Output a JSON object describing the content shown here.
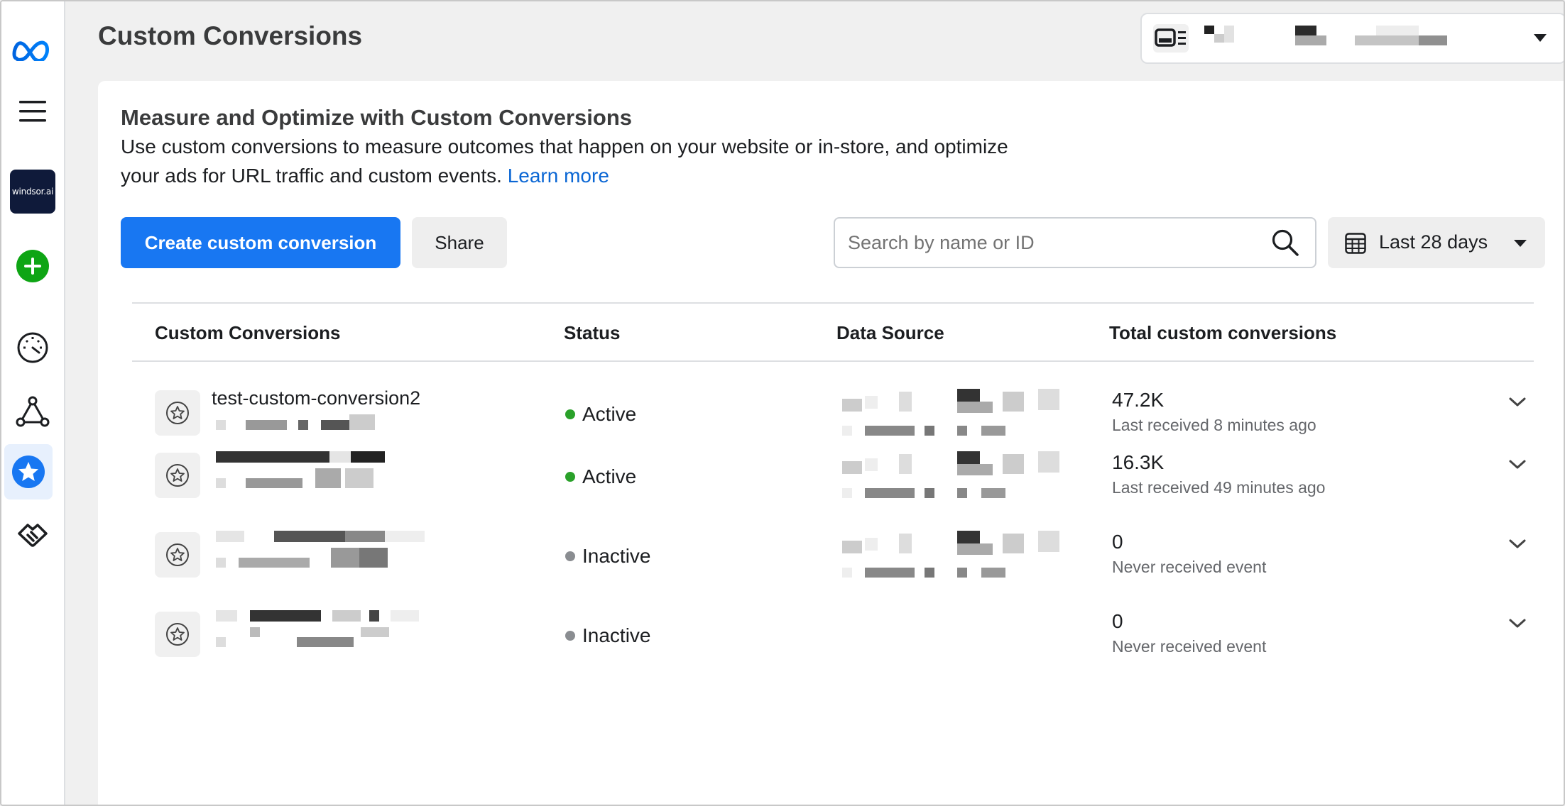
{
  "header": {
    "title": "Custom Conversions"
  },
  "sidebar": {
    "brand_tile_text": "windsor.ai",
    "icons": [
      "meta-logo-icon",
      "menu-icon",
      "brand-tile",
      "create-plus-icon",
      "dashboard-gauge-icon",
      "network-icon",
      "star-icon",
      "partnership-icon"
    ]
  },
  "card": {
    "heading": "Measure and Optimize with Custom Conversions",
    "description": "Use custom conversions to measure outcomes that happen on your website or in-store, and optimize your ads for URL traffic and custom events.",
    "learn_more": "Learn more"
  },
  "toolbar": {
    "create_label": "Create custom conversion",
    "share_label": "Share",
    "search_placeholder": "Search by name or ID",
    "date_range": "Last 28 days"
  },
  "table": {
    "columns": [
      "Custom Conversions",
      "Status",
      "Data Source",
      "Total custom conversions"
    ],
    "rows": [
      {
        "name": "test-custom-conversion2",
        "status": "Active",
        "total": "47.2K",
        "last": "Last received 8 minutes ago"
      },
      {
        "name": "",
        "status": "Active",
        "total": "16.3K",
        "last": "Last received 49 minutes ago"
      },
      {
        "name": "",
        "status": "Inactive",
        "total": "0",
        "last": "Never received event"
      },
      {
        "name": "",
        "status": "Inactive",
        "total": "0",
        "last": "Never received event"
      }
    ]
  },
  "colors": {
    "primary": "#1877f2",
    "active_dot": "#2aa12a",
    "inactive_dot": "#8a8d91",
    "link": "#0a66d4"
  }
}
